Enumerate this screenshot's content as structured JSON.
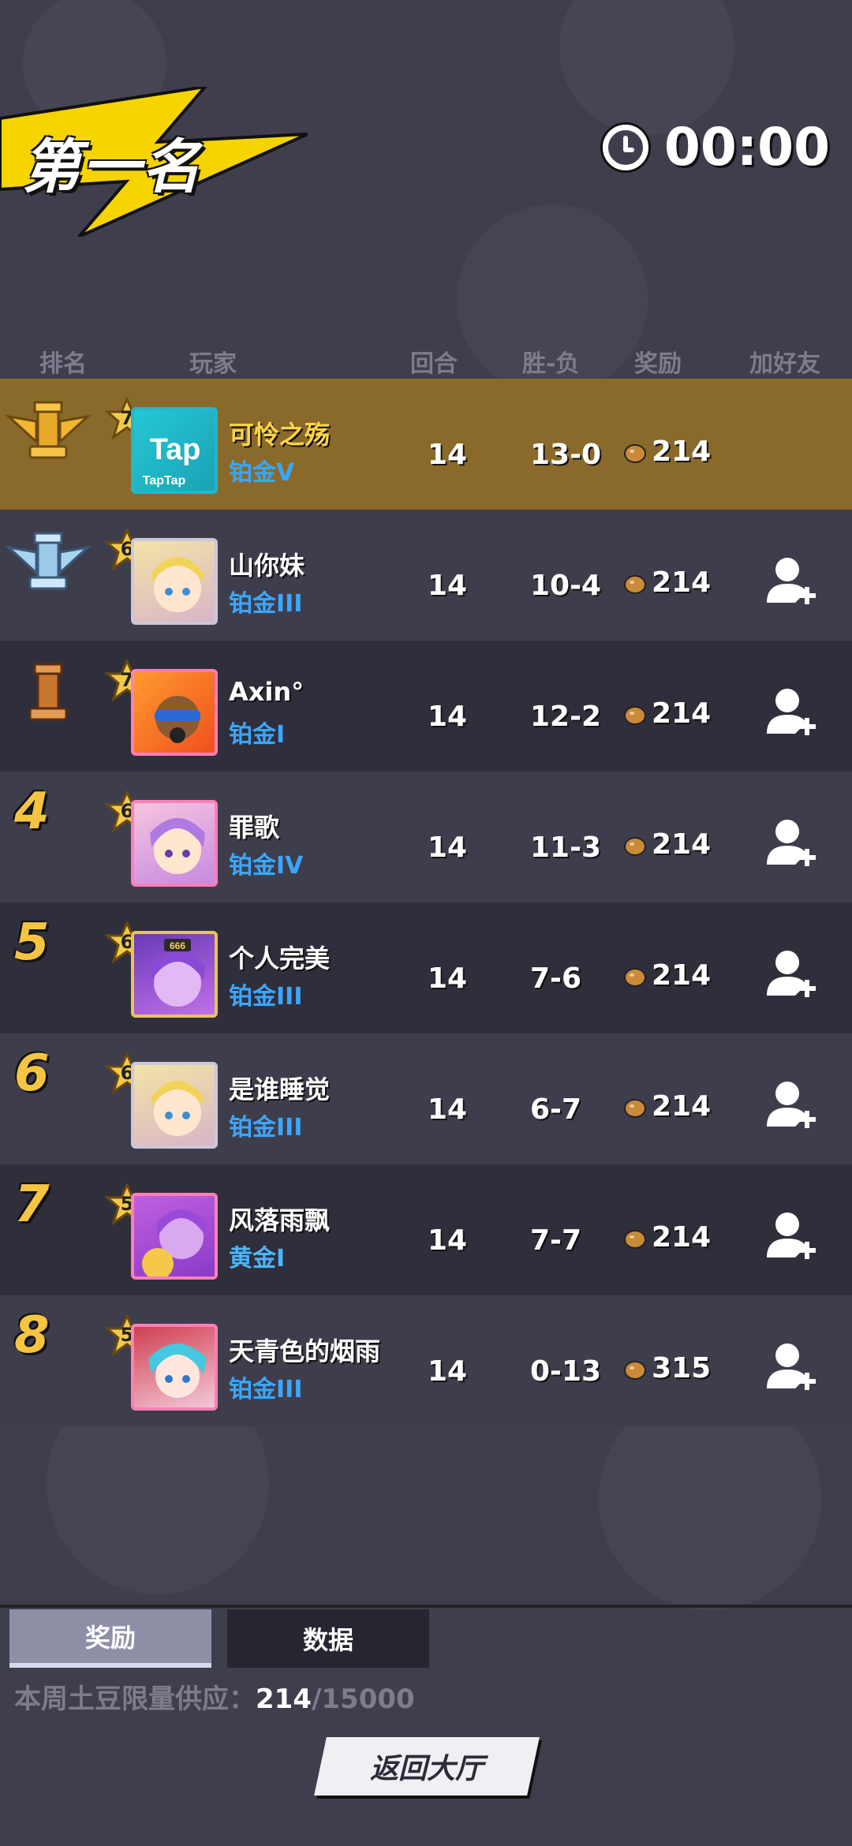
{
  "header": {
    "title": "第一名",
    "timer": "00:00"
  },
  "columns": {
    "rank": "排名",
    "player": "玩家",
    "rounds": "回合",
    "win_loss": "胜-负",
    "reward": "奖励",
    "add_friend": "加好友"
  },
  "rows": [
    {
      "rank": "1",
      "level": "7",
      "name": "可怜之殇",
      "tier": "铂金V",
      "rounds": "14",
      "record": "13-0",
      "reward": "214",
      "is_self": true
    },
    {
      "rank": "2",
      "level": "6",
      "name": "山你妹",
      "tier": "铂金III",
      "rounds": "14",
      "record": "10-4",
      "reward": "214",
      "is_self": false
    },
    {
      "rank": "3",
      "level": "7",
      "name": "Axin°",
      "tier": "铂金I",
      "rounds": "14",
      "record": "12-2",
      "reward": "214",
      "is_self": false
    },
    {
      "rank": "4",
      "level": "6",
      "name": "罪歌",
      "tier": "铂金IV",
      "rounds": "14",
      "record": "11-3",
      "reward": "214",
      "is_self": false
    },
    {
      "rank": "5",
      "level": "6",
      "name": "个人完美",
      "tier": "铂金III",
      "rounds": "14",
      "record": "7-6",
      "reward": "214",
      "is_self": false
    },
    {
      "rank": "6",
      "level": "6",
      "name": "是谁睡觉",
      "tier": "铂金III",
      "rounds": "14",
      "record": "6-7",
      "reward": "214",
      "is_self": false
    },
    {
      "rank": "7",
      "level": "5",
      "name": "风落雨飘",
      "tier": "黄金I",
      "rounds": "14",
      "record": "7-7",
      "reward": "214",
      "is_self": false
    },
    {
      "rank": "8",
      "level": "5",
      "name": "天青色的烟雨",
      "tier": "铂金III",
      "rounds": "14",
      "record": "0-13",
      "reward": "315",
      "is_self": false
    }
  ],
  "avatar_labels": {
    "tap_main": "Tap",
    "tap_sub": "TapTap",
    "badge_666": "666"
  },
  "tabs": {
    "reward": "奖励",
    "data": "数据"
  },
  "supply": {
    "label": "本周土豆限量供应：",
    "current": "214",
    "total": "/15000"
  },
  "back_button": "返回大厅",
  "colors": {
    "self_row": "#8a6a2a",
    "tier_blue": "#3aa7ff",
    "rank_gold": "#f5c542",
    "self_name": "#ffd44a"
  },
  "icons": [
    "clock-icon",
    "crown-gold-icon",
    "crown-silver-icon",
    "crown-bronze-icon",
    "level-star-icon",
    "potato-icon",
    "add-friend-icon"
  ]
}
